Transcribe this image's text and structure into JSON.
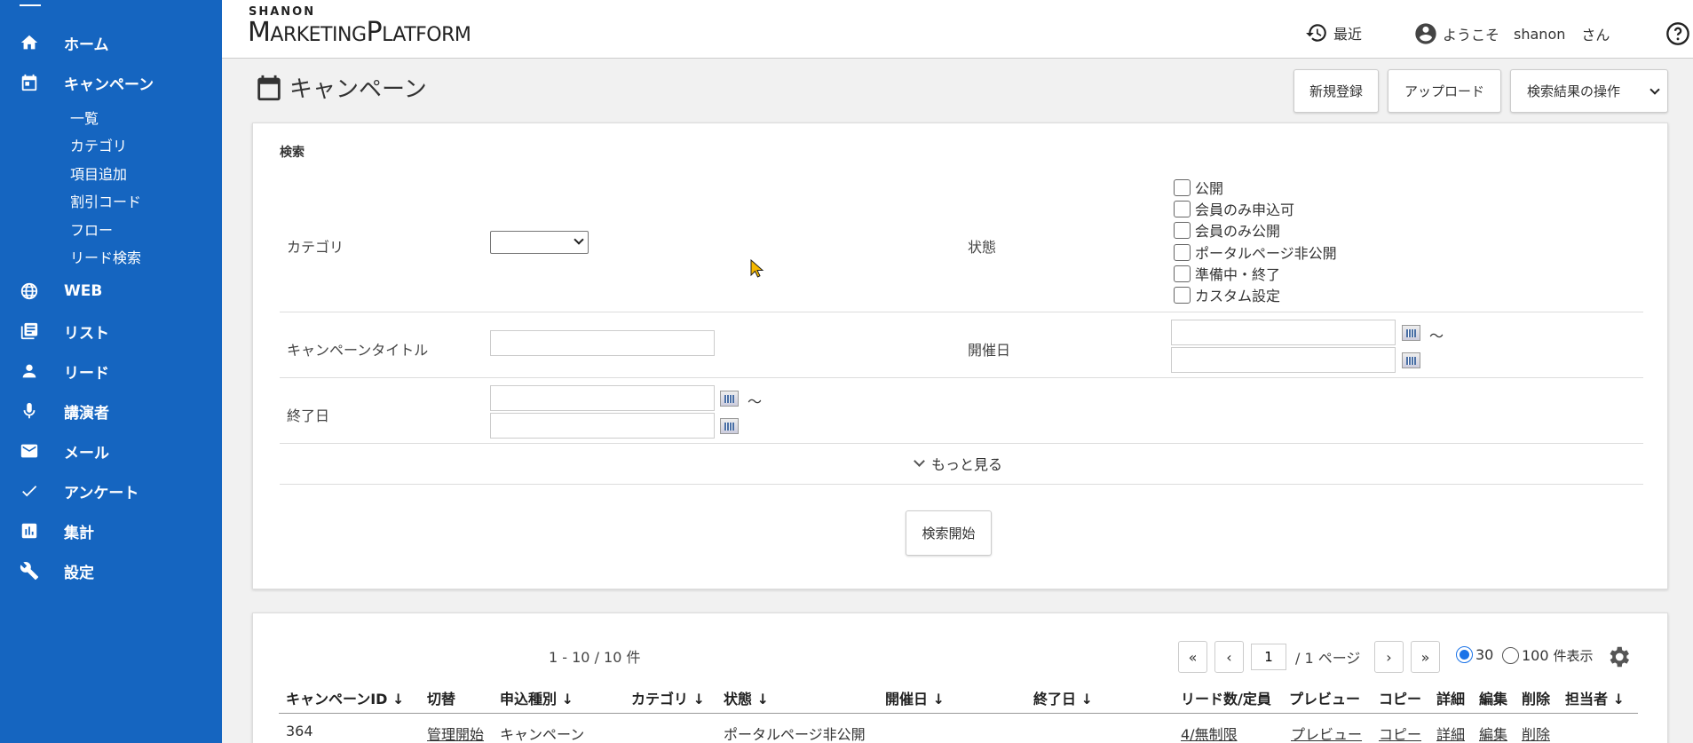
{
  "sidebar": {
    "items": [
      {
        "label": "ホーム",
        "icon": "home-icon"
      },
      {
        "label": "キャンペーン",
        "icon": "calendar-icon"
      },
      {
        "label": "WEB",
        "icon": "globe-icon"
      },
      {
        "label": "リスト",
        "icon": "list-icon"
      },
      {
        "label": "リード",
        "icon": "person-icon"
      },
      {
        "label": "講演者",
        "icon": "microphone-icon"
      },
      {
        "label": "メール",
        "icon": "mail-icon"
      },
      {
        "label": "アンケート",
        "icon": "check-icon"
      },
      {
        "label": "集計",
        "icon": "bar-chart-icon"
      },
      {
        "label": "設定",
        "icon": "wrench-icon"
      }
    ],
    "campaign_sub": [
      "一覧",
      "カテゴリ",
      "項目追加",
      "割引コード",
      "フロー",
      "リード検索"
    ]
  },
  "header": {
    "logo_small": "SHANON",
    "logo_m": "M",
    "logo_arketing": "ARKETING",
    "logo_p": "P",
    "logo_latform": "LATFORM",
    "recent": "最近",
    "welcome": "ようこそ",
    "user": "shanon",
    "suffix": "さん"
  },
  "page": {
    "title": "キャンペーン",
    "new_button": "新規登録",
    "upload_button": "アップロード",
    "actions_select": "検索結果の操作"
  },
  "search": {
    "heading": "検索",
    "category_label": "カテゴリ",
    "category_value": "",
    "status_label": "状態",
    "status_options": [
      "公開",
      "会員のみ申込可",
      "会員のみ公開",
      "ポータルページ非公開",
      "準備中・終了",
      "カスタム設定"
    ],
    "title_label": "キャンペーンタイトル",
    "start_label": "開催日",
    "end_label": "終了日",
    "tilde": "〜",
    "more": "もっと見る",
    "submit": "検索開始"
  },
  "results": {
    "count": "1 - 10 / 10 件",
    "page_value": "1",
    "page_total": "/ 1 ページ",
    "first": "«",
    "prev": "‹",
    "next": "›",
    "last": "»",
    "per30": "30",
    "per100": "100",
    "per_label": "件表示",
    "per_selected": 30,
    "columns": [
      "キャンペーンID ↓",
      "切替",
      "申込種別 ↓",
      "カテゴリ ↓",
      "状態 ↓",
      "開催日 ↓",
      "終了日 ↓",
      "リード数/定員",
      "プレビュー",
      "コピー",
      "詳細",
      "編集",
      "削除",
      "担当者 ↓"
    ],
    "row": {
      "id": "364",
      "toggle": "管理開始",
      "type": "キャンペーン",
      "category": "",
      "status": "ポータルページ非公開",
      "start": "",
      "end": "",
      "leads": "4/無制限",
      "preview": "プレビュー",
      "copy": "コピー",
      "detail": "詳細",
      "edit": "編集",
      "delete": "削除"
    }
  }
}
